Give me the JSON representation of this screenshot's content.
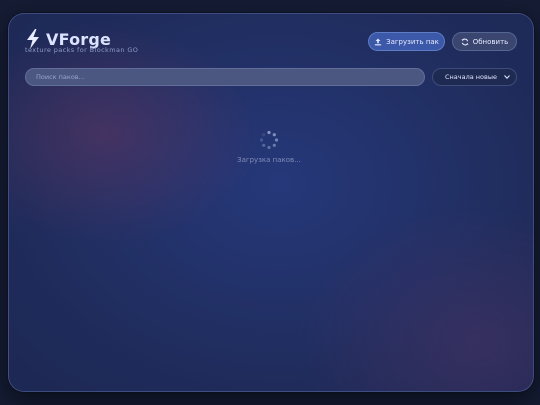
{
  "app": {
    "title": "VForge",
    "subtitle": "texture packs for Blockman GO"
  },
  "toolbar": {
    "upload_label": "Загрузить пак",
    "refresh_label": "Обновить"
  },
  "search": {
    "value": "",
    "placeholder": "Поиск паков..."
  },
  "sort": {
    "selected": "Сначала новые"
  },
  "status": {
    "loading_text": "Загрузка паков..."
  },
  "icons": {
    "logo": "lightning-bolt-icon",
    "upload": "upload-icon",
    "refresh": "refresh-icon",
    "sort": "chevron-down-icon",
    "loading": "spinner-icon"
  },
  "colors": {
    "accent": "#3c58a8",
    "logo_bolt": "#e8ecff",
    "background": "#1f2c5c"
  }
}
